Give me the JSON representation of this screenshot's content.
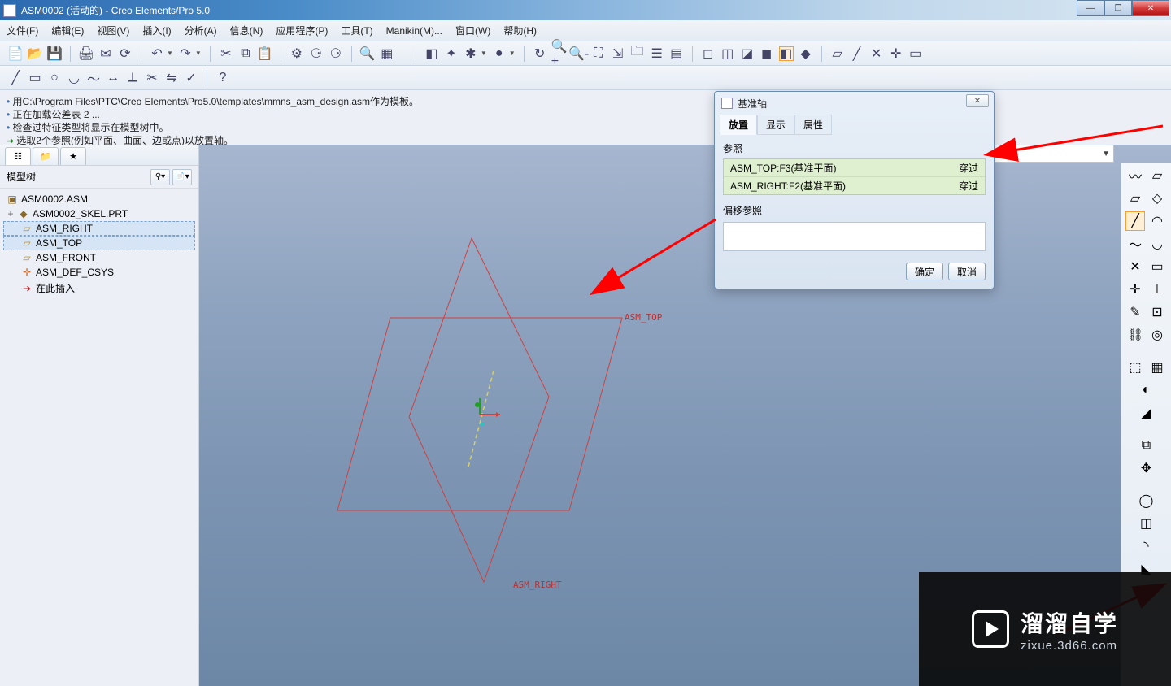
{
  "title": "ASM0002 (活动的) - Creo Elements/Pro 5.0",
  "menus": [
    "文件(F)",
    "编辑(E)",
    "视图(V)",
    "插入(I)",
    "分析(A)",
    "信息(N)",
    "应用程序(P)",
    "工具(T)",
    "Manikin(M)...",
    "窗口(W)",
    "帮助(H)"
  ],
  "messages": [
    {
      "style": "bullet-blue",
      "text": "用C:\\Program Files\\PTC\\Creo Elements\\Pro5.0\\templates\\mmns_asm_design.asm作为模板。"
    },
    {
      "style": "bullet-blue",
      "text": "正在加载公差表 2 ..."
    },
    {
      "style": "bullet-blue",
      "text": "检查过特征类型将显示在模型树中。"
    },
    {
      "style": "bullet-green",
      "text": "选取2个参照(例如平面、曲面、边或点)以放置轴。"
    }
  ],
  "tree_header": "模型树",
  "tree": {
    "root": "ASM0002.ASM",
    "items": [
      {
        "label": "ASM0002_SKEL.PRT",
        "kind": "part",
        "expand": "+",
        "indent": 1
      },
      {
        "label": "ASM_RIGHT",
        "kind": "plane",
        "sel": true,
        "indent": 1
      },
      {
        "label": "ASM_TOP",
        "kind": "plane",
        "sel": true,
        "indent": 1
      },
      {
        "label": "ASM_FRONT",
        "kind": "plane",
        "indent": 1
      },
      {
        "label": "ASM_DEF_CSYS",
        "kind": "csys",
        "indent": 1
      },
      {
        "label": "在此插入",
        "kind": "insert",
        "indent": 1
      }
    ]
  },
  "viewport": {
    "labels": {
      "top": "ASM_TOP",
      "right": "ASM_RIGHT"
    }
  },
  "dialog": {
    "title": "基准轴",
    "tabs": [
      "放置",
      "显示",
      "属性"
    ],
    "active_tab": 0,
    "refs_label": "参照",
    "refs": [
      {
        "name": "ASM_TOP:F3(基准平面)",
        "con": "穿过"
      },
      {
        "name": "ASM_RIGHT:F2(基准平面)",
        "con": "穿过"
      }
    ],
    "offset_label": "偏移参照",
    "ok": "确定",
    "cancel": "取消"
  },
  "watermark": {
    "cn": "溜溜自学",
    "url": "zixue.3d66.com"
  }
}
